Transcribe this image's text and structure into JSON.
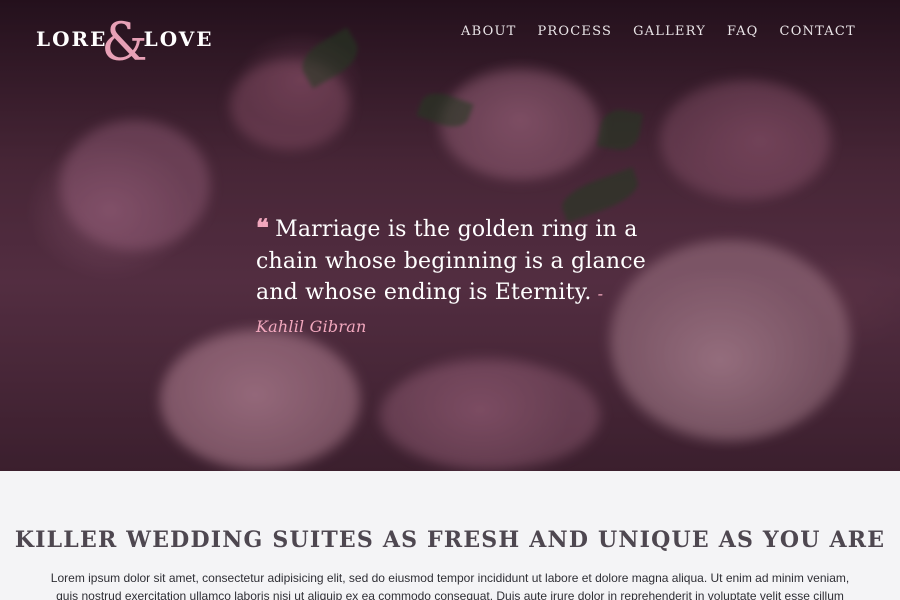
{
  "header": {
    "logo": {
      "part1": "LORE",
      "amp": "&",
      "part2": "LOVE"
    },
    "nav": [
      "ABOUT",
      "PROCESS",
      "GALLERY",
      "FAQ",
      "CONTACT"
    ]
  },
  "hero": {
    "quote_mark": "❝",
    "quote": "Marriage is the golden ring in a chain whose beginning is a glance and whose ending is Eternity.",
    "author": "-Kahlil Gibran"
  },
  "section": {
    "heading": "KILLER WEDDING SUITES AS FRESH AND UNIQUE AS YOU ARE",
    "body": "Lorem ipsum dolor sit amet, consectetur adipisicing elit, sed do eiusmod tempor incididunt ut labore et dolore magna aliqua. Ut enim ad minim veniam, quis nostrud exercitation ullamco laboris nisi ut aliquip ex ea commodo consequat. Duis aute irure dolor in reprehenderit in voluptate velit esse cillum dolore eu fugiat"
  },
  "colors": {
    "accent": "#f2a8be",
    "heading": "#4e4750",
    "background": "#f4f4f6"
  }
}
